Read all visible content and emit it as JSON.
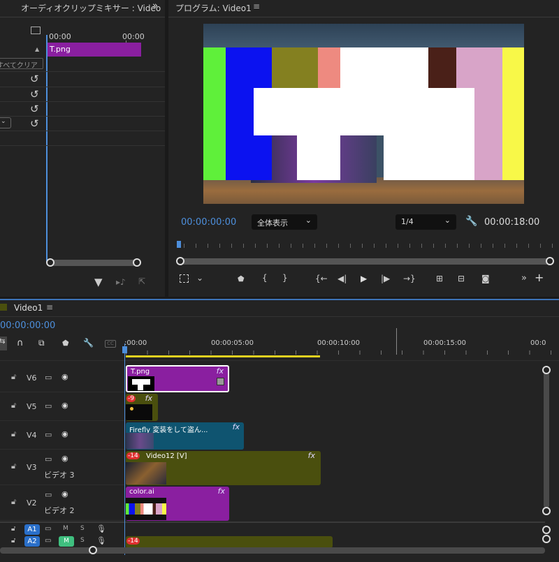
{
  "audio_mixer": {
    "title": "オーディオクリップミキサー : Video",
    "timecodes": [
      "00:00",
      "00:00"
    ],
    "clear_label": "すべてクリア",
    "clip_label": "T.png"
  },
  "program_monitor": {
    "title": "プログラム: Video1",
    "current_time": "00:00:00:00",
    "fit_option": "全体表示",
    "resolution": "1/4",
    "duration": "00:00:18:00"
  },
  "timeline": {
    "sequence_name": "Video1",
    "current_time": "00:00:00:00",
    "ruler_labels": [
      ":00:00",
      "00:00:05:00",
      "00:00:10:00",
      "00:00:15:00",
      "00:0"
    ],
    "tracks": [
      {
        "name": "V6",
        "sub": ""
      },
      {
        "name": "V5",
        "sub": ""
      },
      {
        "name": "V4",
        "sub": ""
      },
      {
        "name": "V3",
        "sub": "ビデオ 3"
      },
      {
        "name": "V2",
        "sub": "ビデオ 2"
      }
    ],
    "audio_tracks": [
      {
        "name": "A1",
        "m": "M",
        "s": "S"
      },
      {
        "name": "A2",
        "m": "M",
        "s": "S"
      }
    ],
    "clips": {
      "v6": {
        "name": "T.png",
        "fx": "fx"
      },
      "v5": {
        "badge": "-9",
        "fx": "fx"
      },
      "v4": {
        "name": "Firefly 変装をして盗ん...",
        "fx": "fx"
      },
      "v3": {
        "badge": "-14",
        "name": "Video12 [V]",
        "fx": "fx"
      },
      "v2": {
        "name": "color.ai",
        "fx": "fx"
      },
      "a2": {
        "badge": "-14"
      }
    }
  },
  "colors": {
    "accent": "#4d8fdc",
    "purple_clip": "#8a1fa0",
    "olive_clip": "#4a4f0e",
    "teal_clip": "#0f5470",
    "playhead": "#4d8fdc",
    "work_area": "#e0d020"
  }
}
